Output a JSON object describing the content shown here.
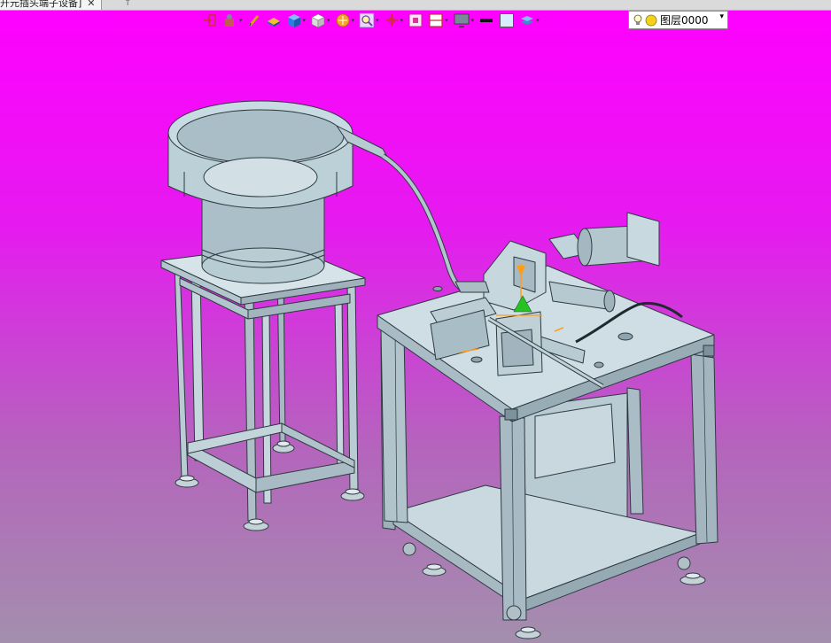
{
  "tab": {
    "title": "开元插头端子设备]",
    "close": "✕",
    "extra": "↑"
  },
  "toolbar": {
    "icons": [
      "exit-sketch-icon",
      "component-icon",
      "pen-icon",
      "part-color-icon",
      "view-cube-icon",
      "box-view-icon",
      "orientation-icon",
      "zoom-fit-icon",
      "center-cross-icon",
      "section-icon",
      "layout-icon",
      "display-mode-icon",
      "line-width-icon",
      "fill-color-icon",
      "layer-stack-icon"
    ]
  },
  "layer": {
    "label": "图层0000",
    "arrow": "▾"
  },
  "colors": {
    "bg_top": "#ff00ff",
    "bg_bottom": "#a38fad",
    "model": "#b8cad2"
  }
}
